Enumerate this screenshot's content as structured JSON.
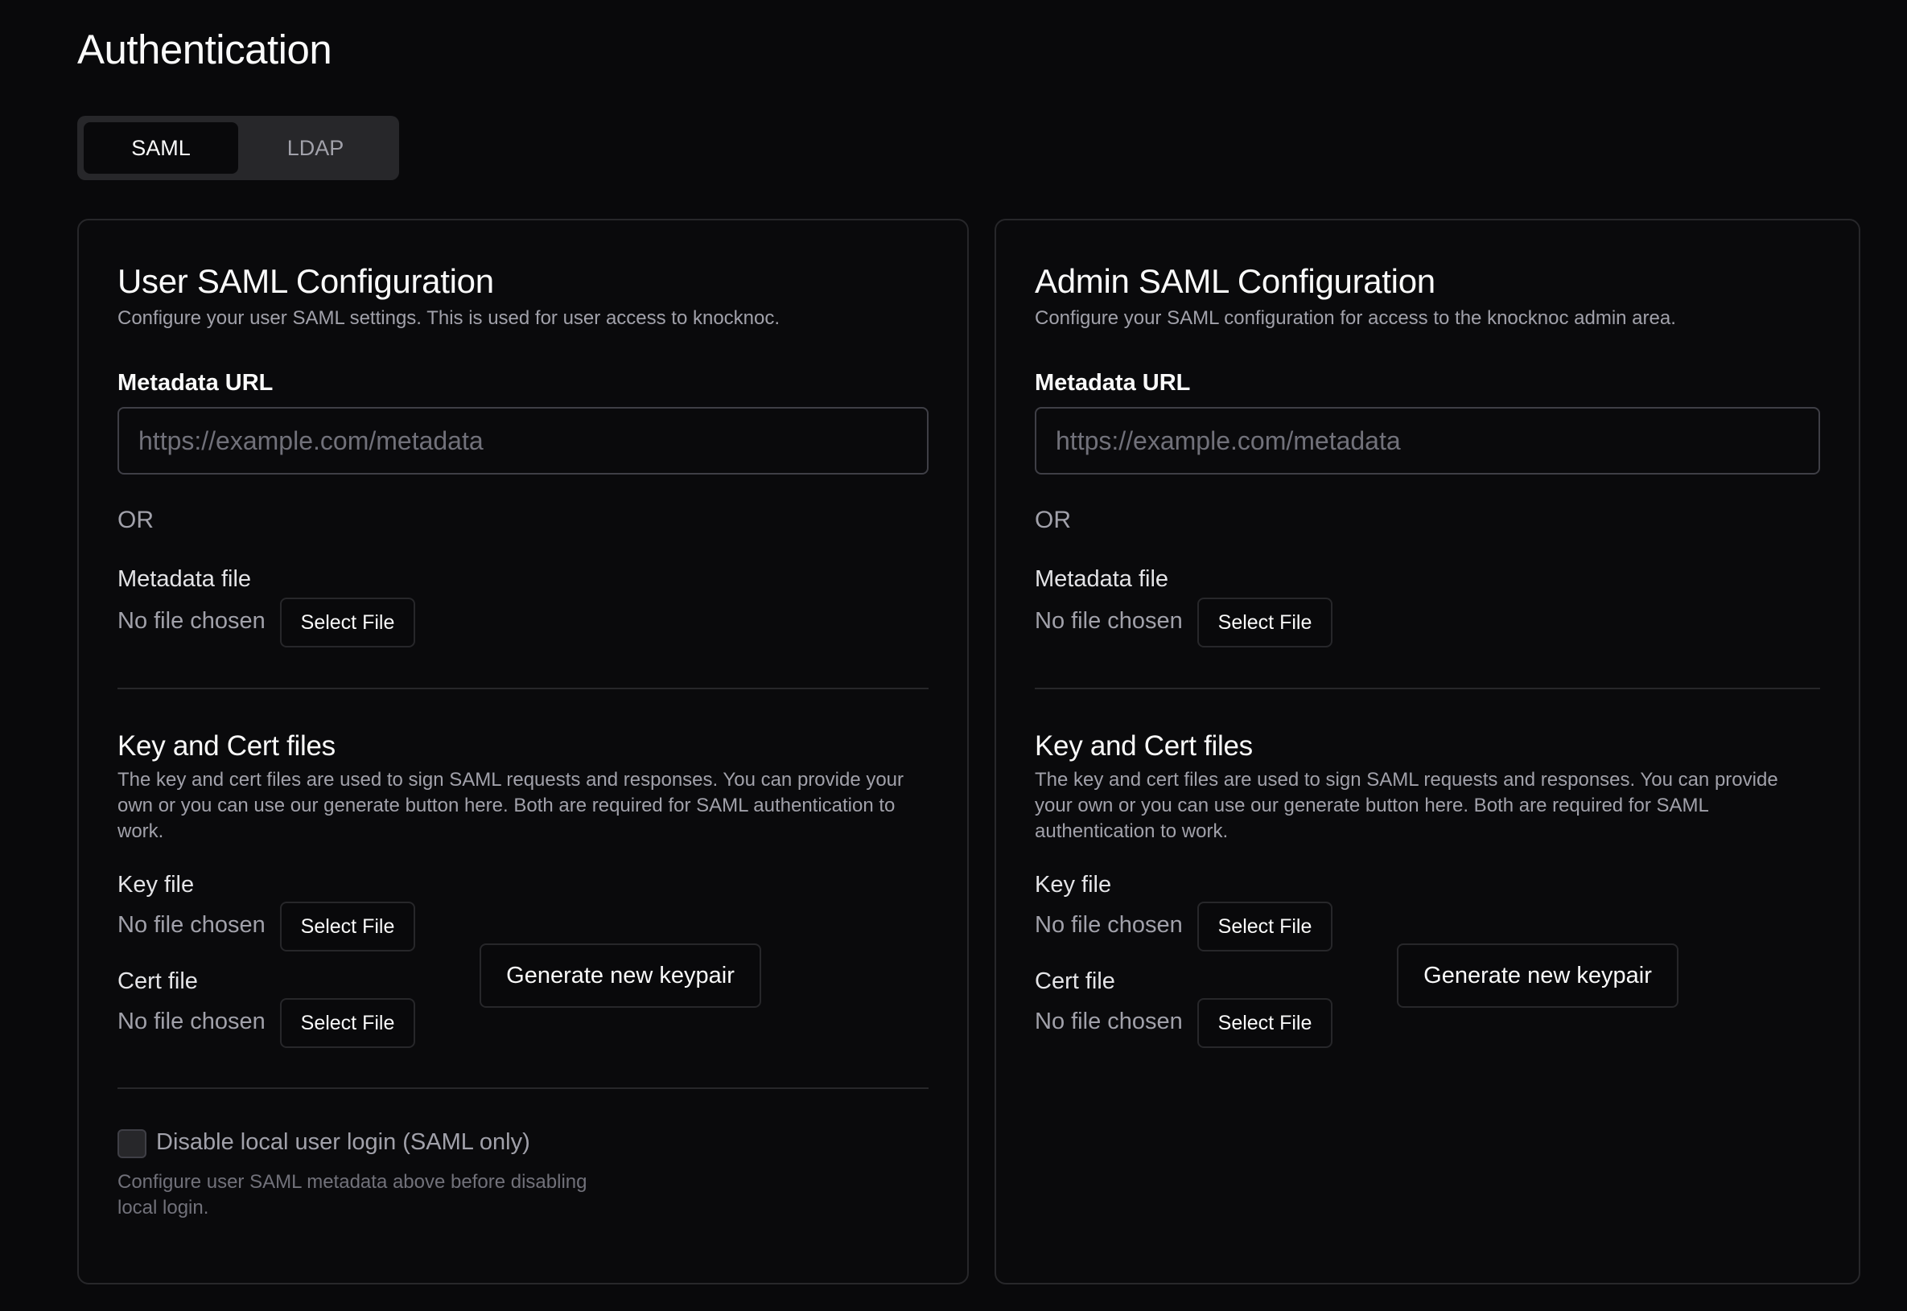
{
  "page": {
    "title": "Authentication"
  },
  "tabs": [
    {
      "label": "SAML",
      "active": true
    },
    {
      "label": "LDAP",
      "active": false
    }
  ],
  "user_config": {
    "title": "User SAML Configuration",
    "description": "Configure your user SAML settings. This is used for user access to knocknoc.",
    "metadata_url_label": "Metadata URL",
    "metadata_url_placeholder": "https://example.com/metadata",
    "metadata_url_value": "",
    "or_label": "OR",
    "metadata_file_label": "Metadata file",
    "metadata_file_status": "No file chosen",
    "select_file_label": "Select File",
    "keycert_title": "Key and Cert files",
    "keycert_desc_lines": [
      "The key and cert files are used to sign SAML requests and responses. You can provide your",
      "own or you can use our generate button here. Both are required for SAML authentication to",
      "work."
    ],
    "key_file_label": "Key file",
    "key_file_status": "No file chosen",
    "cert_file_label": "Cert file",
    "cert_file_status": "No file chosen",
    "generate_label": "Generate new keypair",
    "disable_local_label": "Disable local user login (SAML only)",
    "disable_local_checked": false,
    "disable_hint_lines": [
      "Configure user SAML metadata above before disabling",
      "local login."
    ]
  },
  "admin_config": {
    "title": "Admin SAML Configuration",
    "description": "Configure your SAML configuration for access to the knocknoc admin area.",
    "metadata_url_label": "Metadata URL",
    "metadata_url_placeholder": "https://example.com/metadata",
    "metadata_url_value": "",
    "or_label": "OR",
    "metadata_file_label": "Metadata file",
    "metadata_file_status": "No file chosen",
    "select_file_label": "Select File",
    "keycert_title": "Key and Cert files",
    "keycert_desc_lines": [
      "The key and cert files are used to sign SAML requests and responses. You can provide",
      "your own or you can use our generate button here. Both are required for SAML",
      "authentication to work."
    ],
    "key_file_label": "Key file",
    "key_file_status": "No file chosen",
    "cert_file_label": "Cert file",
    "cert_file_status": "No file chosen",
    "generate_label": "Generate new keypair"
  }
}
